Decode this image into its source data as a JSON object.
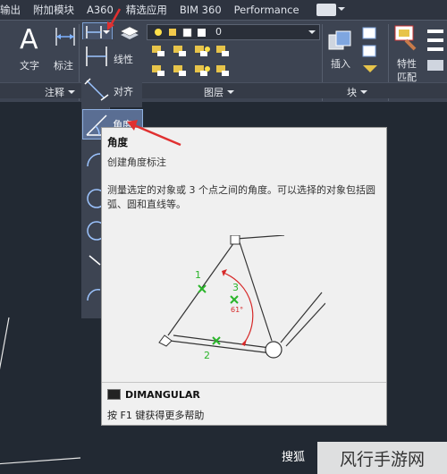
{
  "tabs": [
    "输出",
    "附加模块",
    "A360",
    "精选应用",
    "BIM 360",
    "Performance"
  ],
  "ribbon": {
    "text_label": "文字",
    "annotate_label": "标注",
    "linear_label": "线性",
    "align_label": "对齐",
    "insert_label": "插入",
    "props_label": "特性\n匹配",
    "props_label_line1": "特性",
    "props_label_line2": "匹配",
    "layer_value": "0",
    "panel_annotation": "注释",
    "panel_layers": "图层",
    "panel_block": "块"
  },
  "dropdown": {
    "angle_label": "角度"
  },
  "tooltip": {
    "title": "角度",
    "subtitle": "创建角度标注",
    "description": "测量选定的对象或 3 个点之间的角度。可以选择的对象包括圆弧、圆和直线等。",
    "diagram_labels": [
      "1",
      "2",
      "3",
      "61°"
    ],
    "command": "DIMANGULAR",
    "help": "按 F1 键获得更多帮助"
  },
  "watermark": "风行手游网",
  "bottom_text": "搜狐",
  "colors": {
    "ribbon_bg": "#3d4452",
    "highlight": "#5a6e93",
    "accent_red": "#e03030",
    "marker_green": "#2bb52b"
  }
}
